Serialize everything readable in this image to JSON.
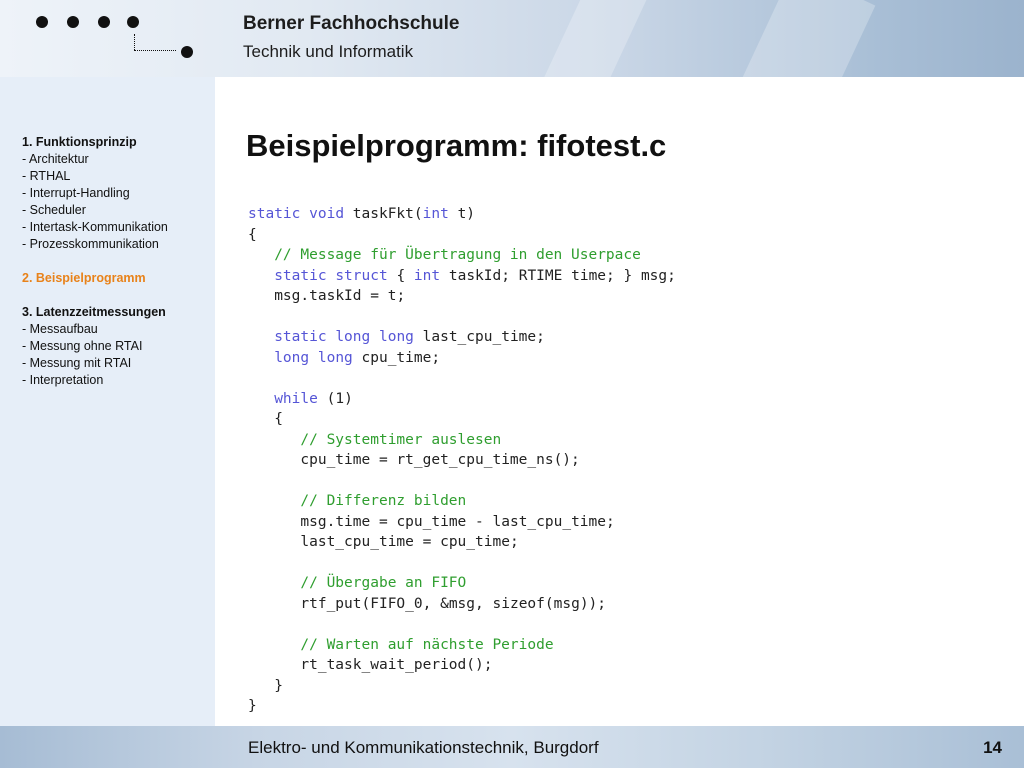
{
  "header": {
    "school": "Berner Fachhochschule",
    "department": "Technik und Informatik"
  },
  "toc": {
    "s1_title": "1. Funktionsprinzip",
    "s1_items": [
      "Architektur",
      "RTHAL",
      "Interrupt-Handling",
      "Scheduler",
      "Intertask-Kommunikation",
      "Prozesskommunikation"
    ],
    "s2_title": "2. Beispielprogramm",
    "s3_title": "3. Latenzzeitmessungen",
    "s3_items": [
      "Messaufbau",
      "Messung ohne RTAI",
      "Messung mit RTAI",
      "Interpretation"
    ],
    "bullet": "-",
    "active_color": "#e8821a"
  },
  "slide": {
    "title": "Beispielprogramm: fifotest.c",
    "code_lines": [
      "static void taskFkt(int t)",
      "{",
      "   // Message für Übertragung in den Userpace",
      "   static struct { int taskId; RTIME time; } msg;",
      "   msg.taskId = t;",
      "",
      "   static long long last_cpu_time;",
      "   long long cpu_time;",
      "",
      "   while (1)",
      "   {",
      "      // Systemtimer auslesen",
      "      cpu_time = rt_get_cpu_time_ns();",
      "",
      "      // Differenz bilden",
      "      msg.time = cpu_time - last_cpu_time;",
      "      last_cpu_time = cpu_time;",
      "",
      "      // Übergabe an FIFO",
      "      rtf_put(FIFO_0, &msg, sizeof(msg));",
      "",
      "      // Warten auf nächste Periode",
      "      rt_task_wait_period();",
      "   }",
      "}"
    ],
    "keywords": [
      "static",
      "void",
      "int",
      "struct",
      "long",
      "while"
    ],
    "keyword_color": "#5555d6",
    "comment_color": "#2f9e2f"
  },
  "footer": {
    "text": "Elektro- und Kommunikationstechnik, Burgdorf",
    "page_number": "14"
  }
}
